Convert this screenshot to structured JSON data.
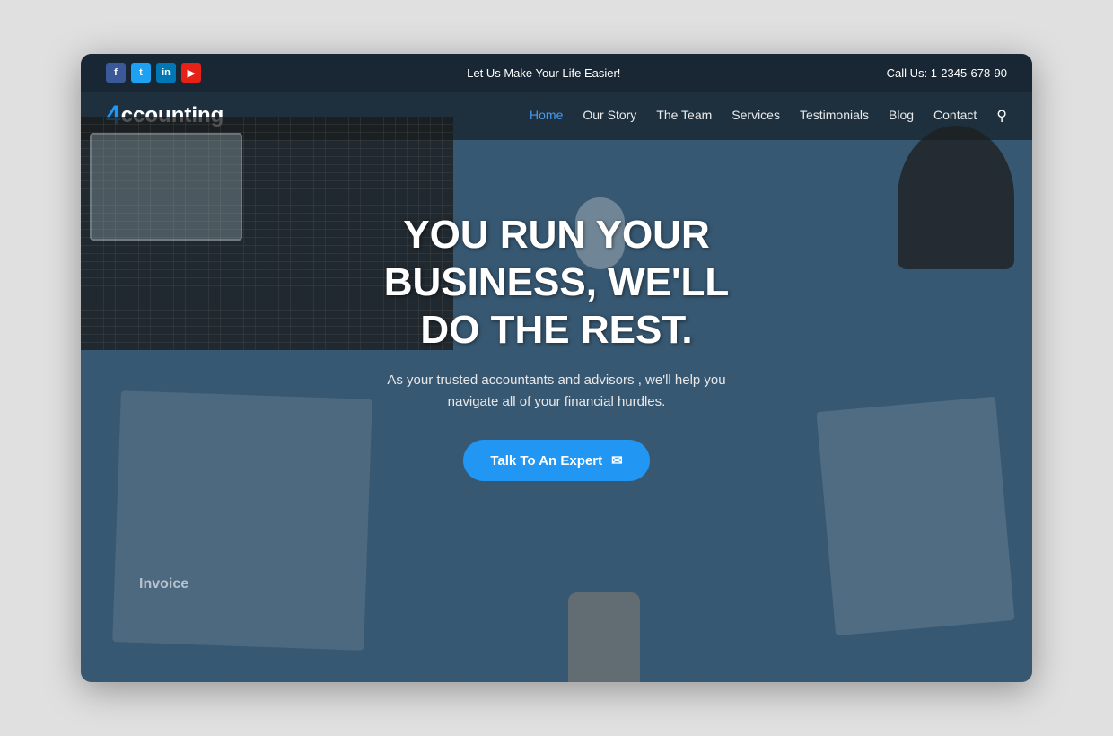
{
  "topbar": {
    "tagline": "Let Us Make Your Life Easier!",
    "phone_label": "Call Us: 1-2345-678-90",
    "social": [
      {
        "name": "Facebook",
        "short": "f",
        "type": "fb"
      },
      {
        "name": "Twitter",
        "short": "t",
        "type": "tw"
      },
      {
        "name": "LinkedIn",
        "short": "in",
        "type": "li"
      },
      {
        "name": "YouTube",
        "short": "▶",
        "type": "yt"
      }
    ]
  },
  "nav": {
    "logo_4": "4",
    "logo_text": "ccounting",
    "links": [
      {
        "label": "Home",
        "active": true
      },
      {
        "label": "Our Story",
        "active": false
      },
      {
        "label": "The Team",
        "active": false
      },
      {
        "label": "Services",
        "active": false
      },
      {
        "label": "Testimonials",
        "active": false
      },
      {
        "label": "Blog",
        "active": false
      },
      {
        "label": "Contact",
        "active": false
      }
    ]
  },
  "hero": {
    "title": "YOU RUN YOUR BUSINESS, WE'LL DO THE REST.",
    "subtitle": "As your trusted accountants and advisors , we'll help you navigate all of your financial hurdles.",
    "cta_label": "Talk To An Expert",
    "invoice_label": "Invoice"
  }
}
